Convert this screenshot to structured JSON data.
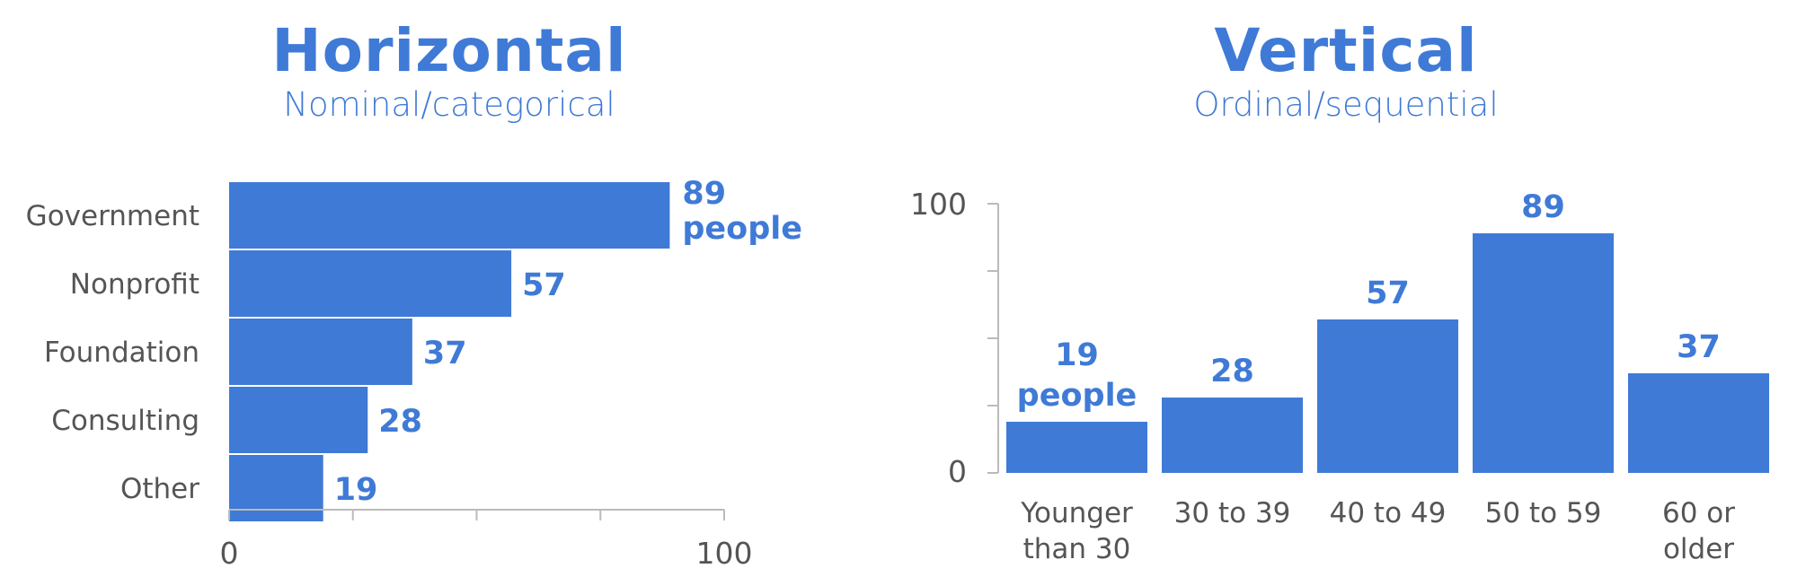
{
  "chart_data": [
    {
      "type": "bar",
      "orientation": "horizontal",
      "title": "Horizontal",
      "subtitle": "Nominal/categorical",
      "categories": [
        "Government",
        "Nonprofit",
        "Foundation",
        "Consulting",
        "Other"
      ],
      "values": [
        89,
        57,
        37,
        28,
        19
      ],
      "value_labels": [
        "89",
        "57",
        "37",
        "28",
        "19"
      ],
      "first_label_unit": "people",
      "xlabel": "",
      "ylabel": "",
      "xlim": [
        0,
        100
      ],
      "tick_values": [
        0,
        25,
        50,
        75,
        100
      ],
      "tick_labels": [
        "0",
        "100"
      ],
      "grid": false,
      "color": "#3f7ad6"
    },
    {
      "type": "bar",
      "orientation": "vertical",
      "title": "Vertical",
      "subtitle": "Ordinal/sequential",
      "categories": [
        [
          "Younger",
          "than 30"
        ],
        [
          "30 to 39"
        ],
        [
          "40 to 49"
        ],
        [
          "50 to 59"
        ],
        [
          "60 or",
          "older"
        ]
      ],
      "values": [
        19,
        28,
        57,
        89,
        37
      ],
      "value_labels": [
        "19",
        "28",
        "57",
        "89",
        "37"
      ],
      "first_label_unit": "people",
      "xlabel": "",
      "ylabel": "",
      "ylim": [
        0,
        100
      ],
      "tick_values": [
        0,
        25,
        50,
        75,
        100
      ],
      "tick_labels": [
        "100",
        "0"
      ],
      "grid": false,
      "color": "#3f7ad6"
    }
  ]
}
